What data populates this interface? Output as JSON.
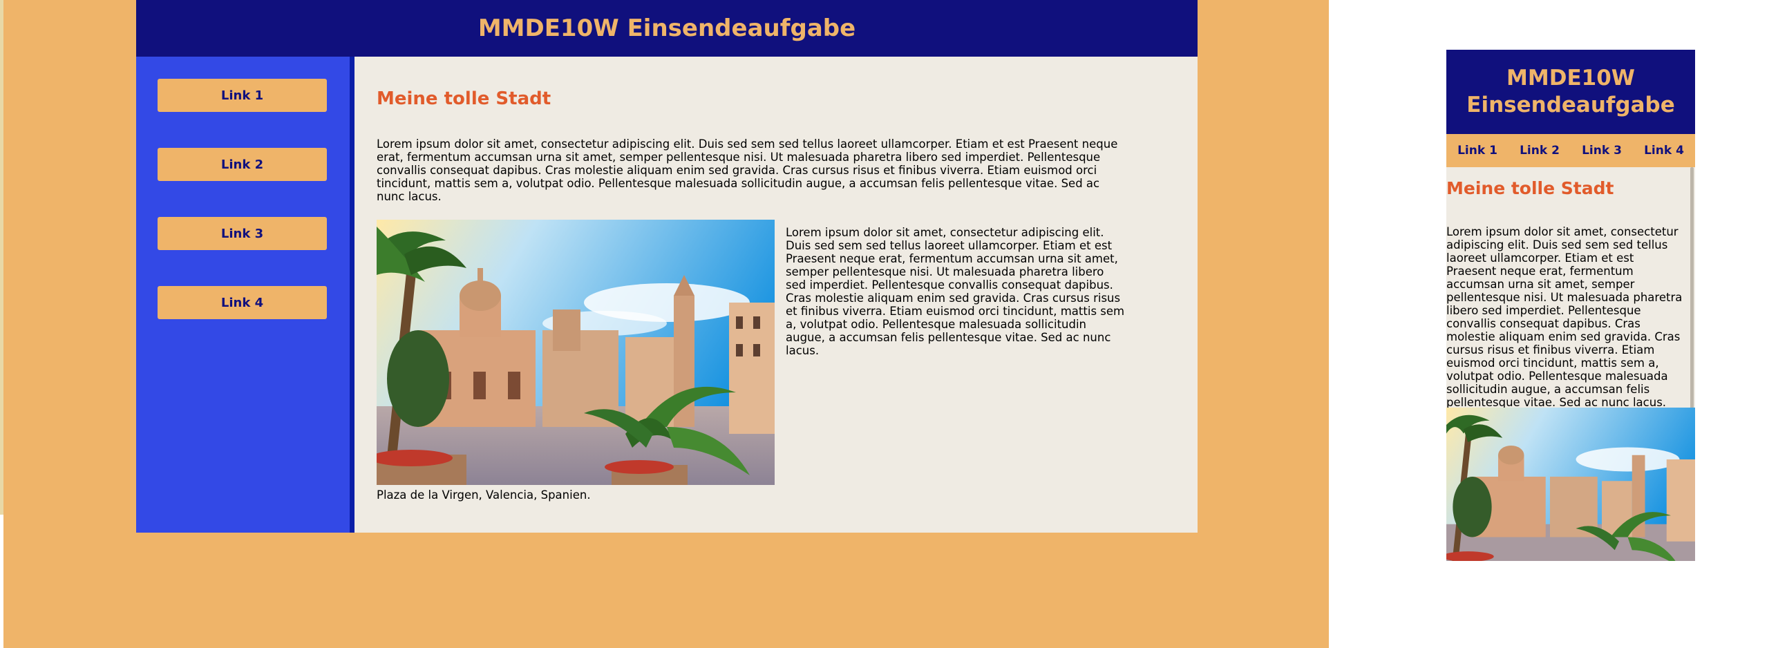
{
  "site": {
    "title": "MMDE10W Einsendeaufgabe",
    "title_line1": "MMDE10W",
    "title_line2": "Einsendeaufgabe"
  },
  "nav": {
    "items": [
      {
        "label": "Link 1"
      },
      {
        "label": "Link 2"
      },
      {
        "label": "Link 3"
      },
      {
        "label": "Link 4"
      }
    ]
  },
  "content": {
    "heading": "Meine tolle Stadt",
    "paragraph1": "Lorem ipsum dolor sit amet, consectetur adipiscing elit. Duis sed sem sed tellus laoreet ullamcorper. Etiam et est Praesent neque erat, fermentum accumsan urna sit amet, semper pellentesque nisi. Ut malesuada pharetra libero sed imperdiet. Pellentesque convallis consequat dapibus. Cras molestie aliquam enim sed gravida. Cras cursus risus et finibus viverra. Etiam euismod orci tincidunt, mattis sem a, volutpat odio. Pellentesque malesuada sollicitudin augue, a accumsan felis pellentesque vitae. Sed ac nunc lacus.",
    "paragraph2": "Lorem ipsum dolor sit amet, consectetur adipiscing elit. Duis sed sem sed tellus laoreet ullamcorper. Etiam et est Praesent neque erat, fermentum accumsan urna sit amet, semper pellentesque nisi. Ut malesuada pharetra libero sed imperdiet. Pellentesque convallis consequat dapibus. Cras molestie aliquam enim sed gravida. Cras cursus risus et finibus viverra. Etiam euismod orci tincidunt, mattis sem a, volutpat odio. Pellentesque malesuada sollicitudin augue, a accumsan felis pellentesque vitae. Sed ac nunc lacus.",
    "caption": "Plaza de la Virgen, Valencia, Spanien."
  },
  "colors": {
    "page_background": "#efb469",
    "header": "#10107d",
    "header_text": "#efb469",
    "sidebar": "#3349e6",
    "content_background": "#efebe3",
    "heading": "#e15b2b"
  }
}
